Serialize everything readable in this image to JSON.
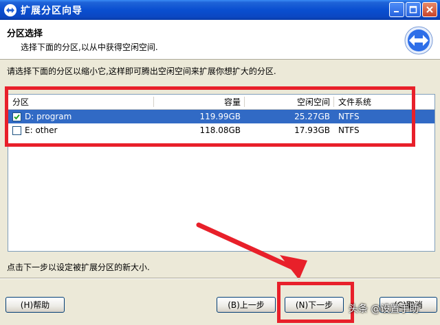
{
  "window": {
    "title": "扩展分区向导"
  },
  "header": {
    "title": "分区选择",
    "subtitle": "选择下面的分区,以从中获得空闲空间."
  },
  "instruction": "请选择下面的分区以缩小它,这样即可腾出空闲空间来扩展你想扩大的分区.",
  "table": {
    "headers": [
      "分区",
      "容量",
      "空闲空间",
      "文件系统"
    ],
    "rows": [
      {
        "name": "D: program",
        "capacity": "119.99GB",
        "free": "25.27GB",
        "fs": "NTFS",
        "checked": true,
        "selected": true
      },
      {
        "name": "E: other",
        "capacity": "118.08GB",
        "free": "17.93GB",
        "fs": "NTFS",
        "checked": false,
        "selected": false
      }
    ]
  },
  "bottom_note": "点击下一步以设定被扩展分区的新大小.",
  "buttons": {
    "help": "(H)帮助",
    "back": "(B)上一步",
    "next": "(N)下一步",
    "cancel": "(C)取消"
  },
  "watermark": "头条 @设置手助",
  "colors": {
    "highlight": "#e8202a",
    "selection": "#316ac5",
    "titlebar": "#0a4fd0"
  }
}
